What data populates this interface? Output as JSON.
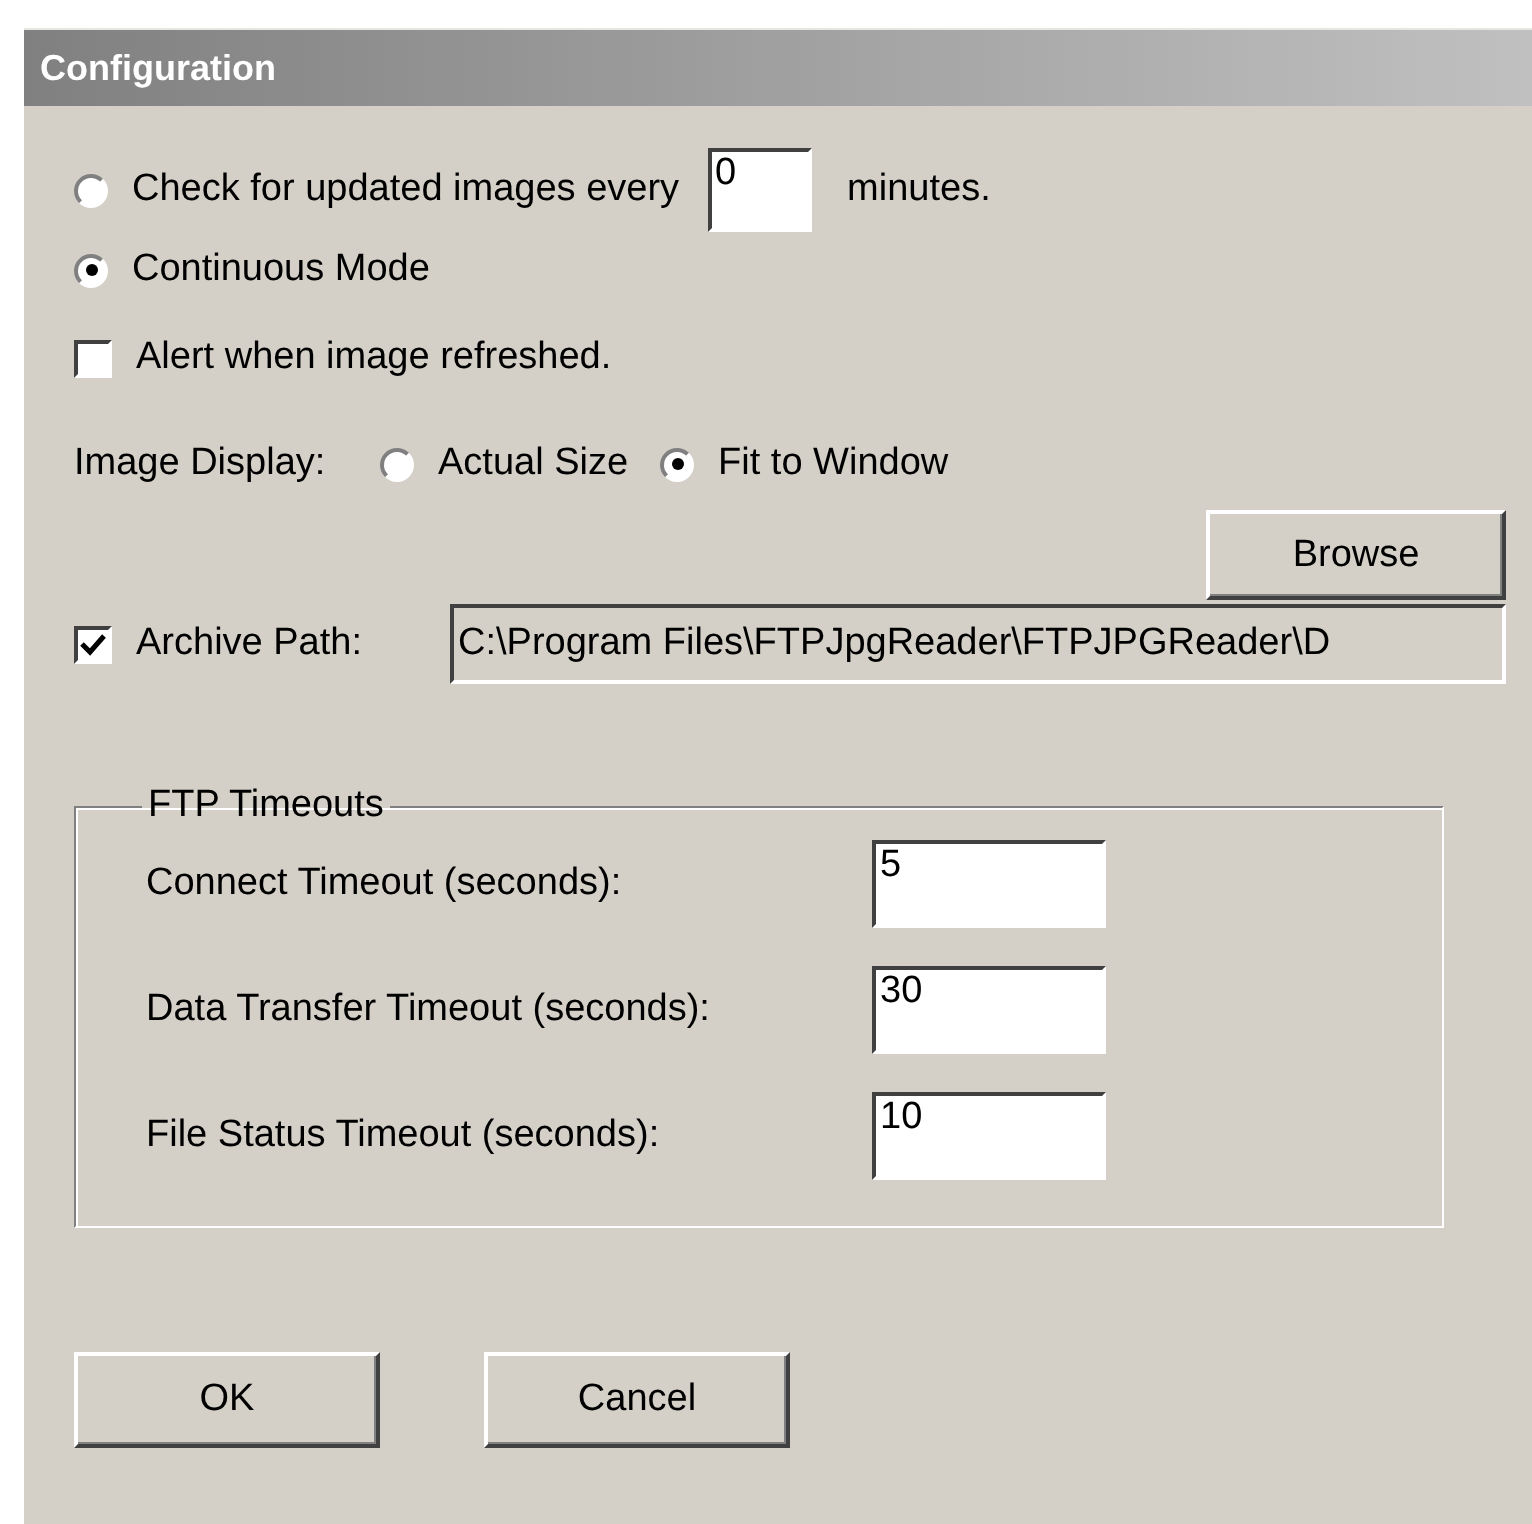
{
  "window": {
    "title": "Configuration"
  },
  "update_mode": [
    {
      "label": "Check for updated images every",
      "selected": false,
      "value": "0",
      "suffix": "minutes."
    },
    {
      "label": "Continuous Mode",
      "selected": true
    }
  ],
  "alert": {
    "label": "Alert when image refreshed.",
    "checked": false
  },
  "image_display": {
    "label": "Image Display:",
    "options": [
      {
        "label": "Actual Size",
        "selected": false
      },
      {
        "label": "Fit to Window",
        "selected": true
      }
    ]
  },
  "browse_button": "Browse",
  "archive": {
    "label": "Archive Path:",
    "checked": true,
    "value": "C:\\Program Files\\FTPJpgReader\\FTPJPGReader\\D"
  },
  "ftp_timeouts": {
    "title": "FTP Timeouts",
    "fields": [
      {
        "label": "Connect Timeout (seconds):",
        "value": "5"
      },
      {
        "label": "Data Transfer Timeout (seconds):",
        "value": "30"
      },
      {
        "label": "File Status Timeout (seconds):",
        "value": "10"
      }
    ]
  },
  "buttons": [
    "OK",
    "Cancel"
  ]
}
